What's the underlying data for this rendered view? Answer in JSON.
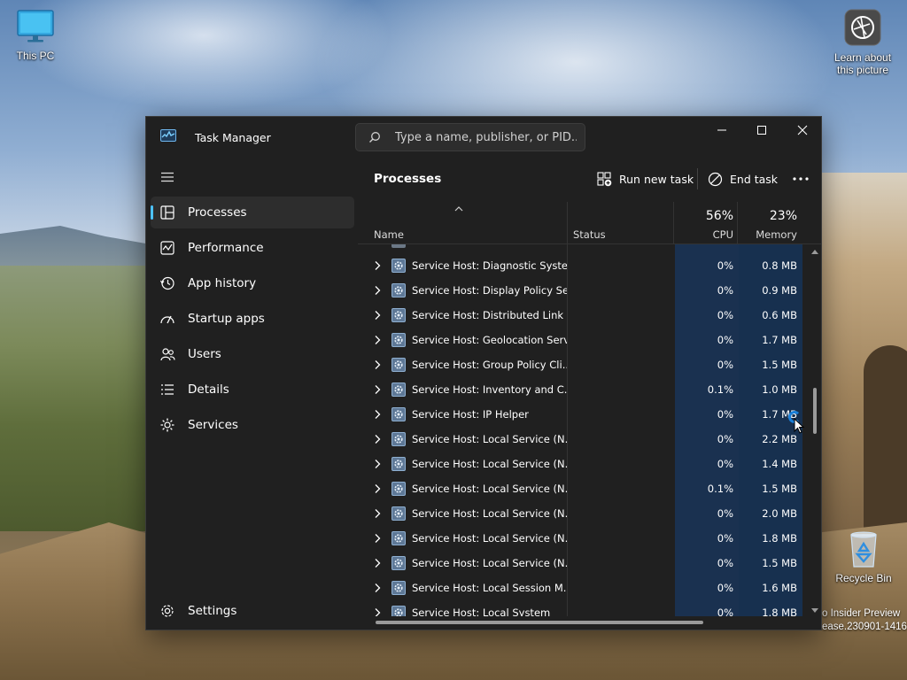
{
  "desktop": {
    "icons": {
      "this_pc": "This PC",
      "learn_line1": "Learn about",
      "learn_line2": "this picture",
      "recycle_bin": "Recycle Bin"
    },
    "watermark_line1": "o Insider Preview",
    "watermark_line2": "ease.230901-1416"
  },
  "window": {
    "title": "Task Manager",
    "search_placeholder": "Type a name, publisher, or PID..."
  },
  "sidebar": {
    "items": [
      {
        "label": "Processes",
        "icon": "processes-icon"
      },
      {
        "label": "Performance",
        "icon": "performance-icon"
      },
      {
        "label": "App history",
        "icon": "app-history-icon"
      },
      {
        "label": "Startup apps",
        "icon": "startup-apps-icon"
      },
      {
        "label": "Users",
        "icon": "users-icon"
      },
      {
        "label": "Details",
        "icon": "details-icon"
      },
      {
        "label": "Services",
        "icon": "services-icon"
      }
    ],
    "settings": "Settings",
    "active_index": 0
  },
  "main": {
    "title": "Processes",
    "run_new_task": "Run new task",
    "end_task": "End task"
  },
  "columns": {
    "name": "Name",
    "status": "Status",
    "cpu_pct": "56%",
    "cpu": "CPU",
    "memory_pct": "23%",
    "memory": "Memory"
  },
  "processes": [
    {
      "name": "Service Host: Diagnostic Syste...",
      "cpu": "0%",
      "memory": "0.8 MB"
    },
    {
      "name": "Service Host: Display Policy Se...",
      "cpu": "0%",
      "memory": "0.9 MB"
    },
    {
      "name": "Service Host: Distributed Link ...",
      "cpu": "0%",
      "memory": "0.6 MB"
    },
    {
      "name": "Service Host: Geolocation Serv...",
      "cpu": "0%",
      "memory": "1.7 MB"
    },
    {
      "name": "Service Host: Group Policy Cli...",
      "cpu": "0%",
      "memory": "1.5 MB"
    },
    {
      "name": "Service Host: Inventory and C...",
      "cpu": "0.1%",
      "memory": "1.0 MB"
    },
    {
      "name": "Service Host: IP Helper",
      "cpu": "0%",
      "memory": "1.7 MB"
    },
    {
      "name": "Service Host: Local Service (N...",
      "cpu": "0%",
      "memory": "2.2 MB"
    },
    {
      "name": "Service Host: Local Service (N...",
      "cpu": "0%",
      "memory": "1.4 MB"
    },
    {
      "name": "Service Host: Local Service (N...",
      "cpu": "0.1%",
      "memory": "1.5 MB"
    },
    {
      "name": "Service Host: Local Service (N...",
      "cpu": "0%",
      "memory": "2.0 MB"
    },
    {
      "name": "Service Host: Local Service (N...",
      "cpu": "0%",
      "memory": "1.8 MB"
    },
    {
      "name": "Service Host: Local Service (N...",
      "cpu": "0%",
      "memory": "1.5 MB"
    },
    {
      "name": "Service Host: Local Session M...",
      "cpu": "0%",
      "memory": "1.6 MB"
    },
    {
      "name": "Service Host: Local System",
      "cpu": "0%",
      "memory": "1.8 MB"
    }
  ],
  "colors": {
    "accent": "#4cc2ff",
    "window_bg": "#202020",
    "cpu_column": "#1a3150"
  }
}
